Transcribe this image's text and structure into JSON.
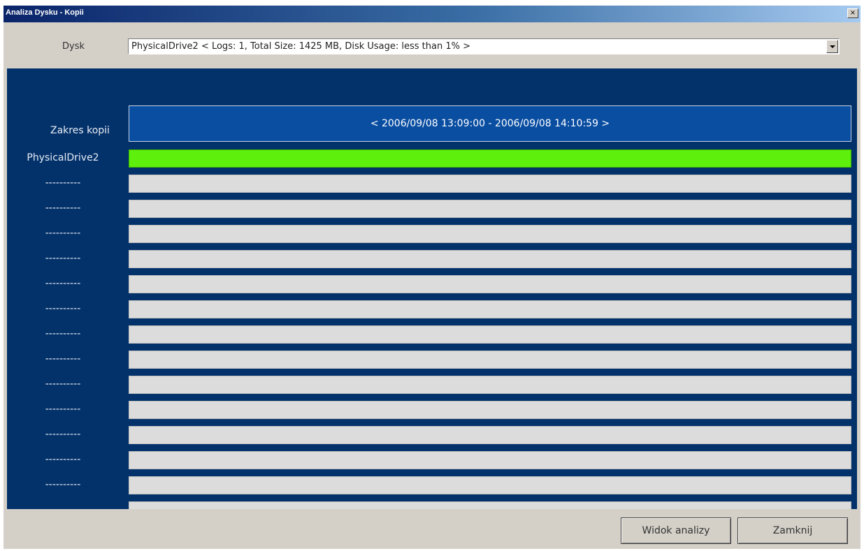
{
  "window": {
    "title": "Analiza Dysku - Kopii",
    "close_glyph": "×"
  },
  "disk": {
    "label": "Dysk",
    "selected": "PhysicalDrive2   < Logs: 1, Total Size: 1425 MB, Disk Usage: less than 1% >"
  },
  "range": {
    "label": "Zakres kopii",
    "value": "< 2006/09/08 13:09:00 - 2006/09/08 14:10:59 >"
  },
  "tracks": [
    {
      "label": "PhysicalDrive2",
      "active": true
    },
    {
      "label": "----------",
      "active": false
    },
    {
      "label": "----------",
      "active": false
    },
    {
      "label": "----------",
      "active": false
    },
    {
      "label": "----------",
      "active": false
    },
    {
      "label": "----------",
      "active": false
    },
    {
      "label": "----------",
      "active": false
    },
    {
      "label": "----------",
      "active": false
    },
    {
      "label": "----------",
      "active": false
    },
    {
      "label": "----------",
      "active": false
    },
    {
      "label": "----------",
      "active": false
    },
    {
      "label": "----------",
      "active": false
    },
    {
      "label": "----------",
      "active": false
    },
    {
      "label": "----------",
      "active": false
    },
    {
      "label": "----------",
      "active": false
    }
  ],
  "buttons": {
    "analysis_view": "Widok analizy",
    "close": "Zamknij"
  },
  "colors": {
    "panel_bg": "#03326b",
    "range_bg": "#0a4ea2",
    "active_track": "#5ef00c",
    "inactive_track": "#dcdcdc",
    "dialog_bg": "#d4d0c8"
  }
}
